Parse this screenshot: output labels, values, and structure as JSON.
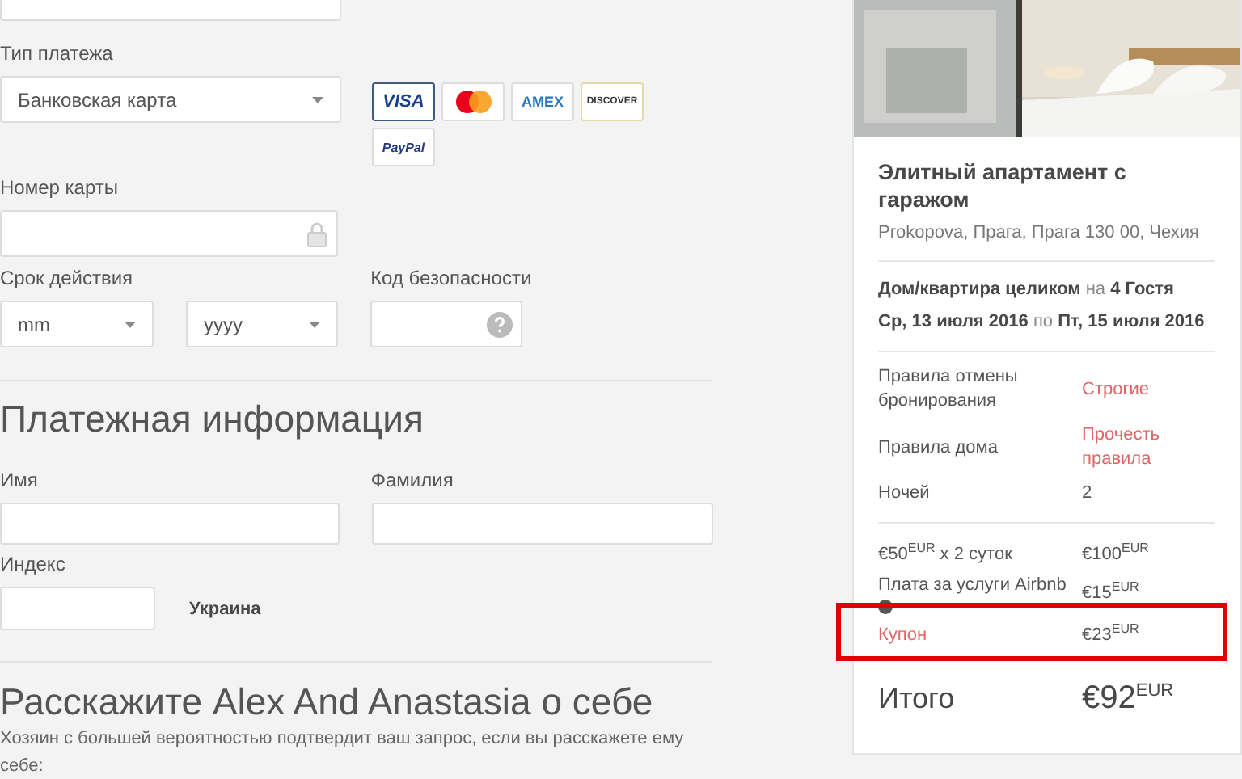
{
  "payment_form": {
    "payment_type": {
      "label": "Тип платежа",
      "value": "Банковская карта"
    },
    "payment_methods": [
      {
        "kind": "visa",
        "label": "VISA",
        "selected": true
      },
      {
        "kind": "mastercard",
        "selected": false
      },
      {
        "kind": "amex",
        "label": "AMEX",
        "selected": false
      },
      {
        "kind": "discover",
        "label": "DISCOVER",
        "selected": false
      },
      {
        "kind": "paypal",
        "label": "PayPal",
        "selected": false
      }
    ],
    "card_number": {
      "label": "Номер карты"
    },
    "expiry": {
      "label": "Срок действия",
      "month": "mm",
      "year": "yyyy"
    },
    "security_code": {
      "label": "Код безопасности"
    }
  },
  "billing": {
    "heading": "Платежная информация",
    "first_name": {
      "label": "Имя"
    },
    "last_name": {
      "label": "Фамилия"
    },
    "postal_code": {
      "label": "Индекс"
    },
    "country": "Украина"
  },
  "about": {
    "heading": "Расскажите Alex And Anastasia о себе",
    "text": "Хозяин с большей вероятностью подтвердит ваш запрос, если вы расскажете ему себе:"
  },
  "listing": {
    "title": "Элитный апартамент с гаражом",
    "address": "Prokopova, Прага, Прага 130 00, Чехия",
    "stay": "**Дом/квартира целиком** на **4 Гостя**",
    "dates": "**Ср, 13 июля 2016** по **Пт, 15 июля 2016**",
    "rules": [
      {
        "label": "Правила отмены бронирования",
        "value": "Строгие",
        "link": true
      },
      {
        "label": "Правила дома",
        "value": "Прочесть правила",
        "link": true
      },
      {
        "label": "Ночей",
        "value": "2",
        "link": false
      }
    ],
    "fees": [
      {
        "label": "€50$^{EUR}$ x 2 суток",
        "value": "€100$^{EUR}$",
        "info": false,
        "link": false,
        "highlighted": false
      },
      {
        "label": "Плата за услуги Airbnb",
        "value": "€15$^{EUR}$",
        "info": true,
        "link": false,
        "highlighted": false
      },
      {
        "label": "Купон",
        "value": "€23$^{EUR}$",
        "info": false,
        "link": true,
        "highlighted": true
      }
    ],
    "total": {
      "label": "Итого",
      "value": "€92$^{EUR}$"
    }
  }
}
